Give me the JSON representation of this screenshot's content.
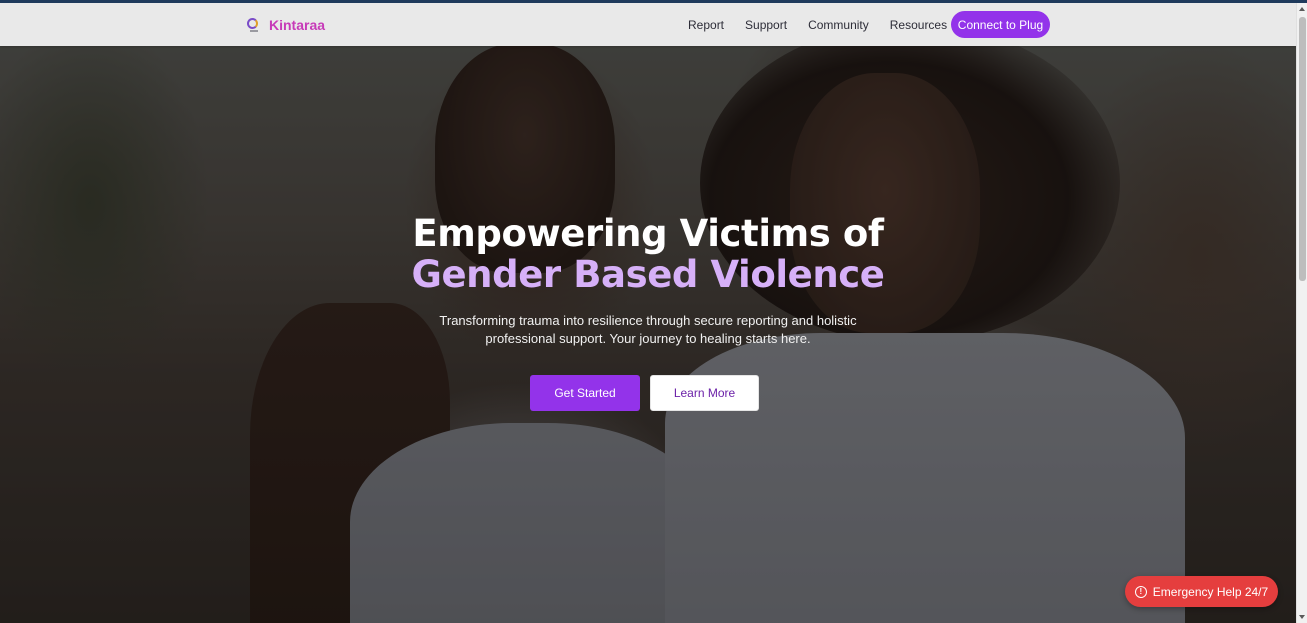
{
  "brand": {
    "name": "Kintaraa",
    "logo_icon": "kintaraa-logo-icon"
  },
  "nav": {
    "links": [
      "Report",
      "Support",
      "Community",
      "Resources"
    ],
    "cta_label": "Connect to Plug"
  },
  "hero": {
    "title_line1": "Empowering Victims of",
    "title_line2": "Gender Based Violence",
    "subtitle": "Transforming trauma into resilience through secure reporting and holistic professional support. Your journey to healing starts here.",
    "primary_button": "Get Started",
    "secondary_button": "Learn More"
  },
  "emergency": {
    "label": "Emergency Help 24/7",
    "icon": "alert-circle-icon"
  },
  "colors": {
    "accent": "#9333ea",
    "brand_text": "#c73ab8",
    "title_highlight": "#d6b0f8",
    "emergency": "#e53e3e"
  }
}
